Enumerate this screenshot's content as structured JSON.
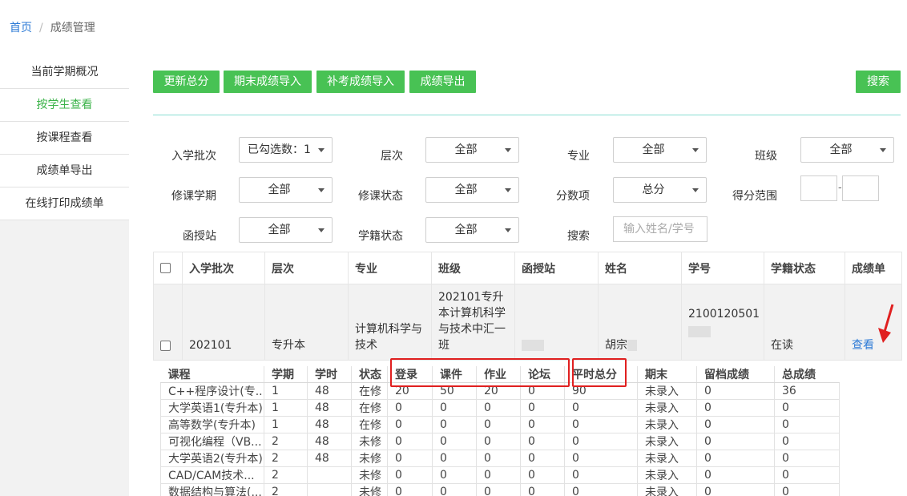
{
  "breadcrumb": {
    "home": "首页",
    "separator": "/",
    "current": "成绩管理"
  },
  "sidebar": {
    "items": [
      {
        "label": "当前学期概况",
        "active": false
      },
      {
        "label": "按学生查看",
        "active": true
      },
      {
        "label": "按课程查看",
        "active": false
      },
      {
        "label": "成绩单导出",
        "active": false
      },
      {
        "label": "在线打印成绩单",
        "active": false
      }
    ]
  },
  "toolbar": {
    "update_total": "更新总分",
    "final_import": "期末成绩导入",
    "makeup_import": "补考成绩导入",
    "export": "成绩导出",
    "search": "搜索"
  },
  "filters": {
    "batch": {
      "label": "入学批次",
      "value": "已勾选数：1"
    },
    "level": {
      "label": "层次",
      "value": "全部"
    },
    "major": {
      "label": "专业",
      "value": "全部"
    },
    "class": {
      "label": "班级",
      "value": "全部"
    },
    "term": {
      "label": "修课学期",
      "value": "全部"
    },
    "course_status": {
      "label": "修课状态",
      "value": "全部"
    },
    "score_item": {
      "label": "分数项",
      "value": "总分"
    },
    "score_range": {
      "label": "得分范围",
      "separator": "-"
    },
    "station": {
      "label": "函授站",
      "value": "全部"
    },
    "enroll_status": {
      "label": "学籍状态",
      "value": "全部"
    },
    "search": {
      "label": "搜索",
      "placeholder": "输入姓名/学号"
    }
  },
  "student_table": {
    "headers": [
      "入学批次",
      "层次",
      "专业",
      "班级",
      "函授站",
      "姓名",
      "学号",
      "学籍状态",
      "成绩单"
    ],
    "row": {
      "batch": "202101",
      "level": "专升本",
      "major": "计算机科学与技术",
      "class": "202101专升本计算机科学与技术中汇一班",
      "station": "",
      "name": "胡宗",
      "student_id": "2100120501",
      "status": "在读",
      "action": "查看"
    }
  },
  "course_table": {
    "headers": [
      "课程",
      "学期",
      "学时",
      "状态",
      "登录",
      "课件",
      "作业",
      "论坛",
      "平时总分",
      "期末",
      "留档成绩",
      "总成绩"
    ],
    "rows": [
      [
        "C++程序设计(专...",
        "1",
        "48",
        "在修",
        "20",
        "50",
        "20",
        "0",
        "90",
        "未录入",
        "0",
        "36"
      ],
      [
        "大学英语1(专升本)",
        "1",
        "48",
        "在修",
        "0",
        "0",
        "0",
        "0",
        "0",
        "未录入",
        "0",
        "0"
      ],
      [
        "高等数学(专升本)",
        "1",
        "48",
        "在修",
        "0",
        "0",
        "0",
        "0",
        "0",
        "未录入",
        "0",
        "0"
      ],
      [
        "可视化编程（VB...",
        "2",
        "48",
        "未修",
        "0",
        "0",
        "0",
        "0",
        "0",
        "未录入",
        "0",
        "0"
      ],
      [
        "大学英语2(专升本)",
        "2",
        "48",
        "未修",
        "0",
        "0",
        "0",
        "0",
        "0",
        "未录入",
        "0",
        "0"
      ],
      [
        "CAD/CAM技术...",
        "2",
        "",
        "未修",
        "0",
        "0",
        "0",
        "0",
        "0",
        "未录入",
        "0",
        "0"
      ],
      [
        "数据结构与算法(...",
        "2",
        "",
        "未修",
        "0",
        "0",
        "0",
        "0",
        "0",
        "未录入",
        "0",
        "0"
      ]
    ]
  },
  "colors": {
    "accent": "#48c254",
    "link": "#2c7ad6",
    "highlight": "#e02020"
  }
}
